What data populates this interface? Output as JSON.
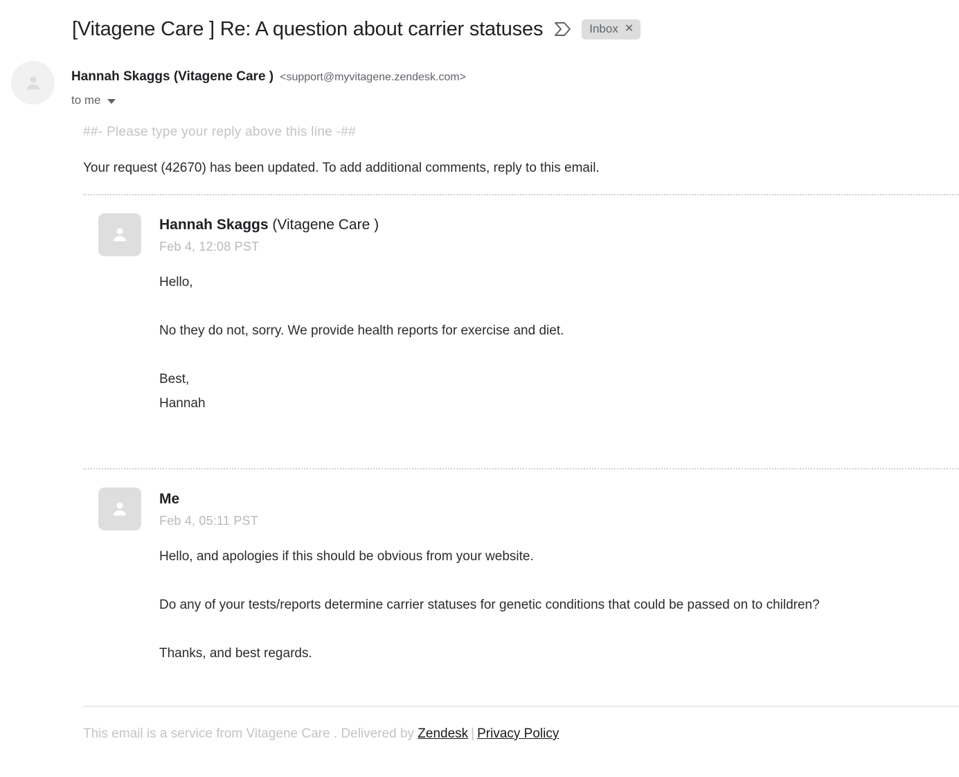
{
  "header": {
    "subject": "[Vitagene Care ] Re: A question about carrier statuses",
    "inbox_arrow_icon": "inbox-arrow-icon",
    "label": "Inbox",
    "label_close": "✕"
  },
  "sender": {
    "avatar_icon": "person-avatar-icon",
    "name": "Hannah Skaggs (Vitagene Care )",
    "email": "<support@myvitagene.zendesk.com>",
    "recipients": "to me",
    "expand_icon": "chevron-down-icon"
  },
  "notice": {
    "reply_above": "##- Please type your reply above this line -##",
    "request_updated": "Your request (42670) has been updated. To add additional comments, reply to this email."
  },
  "comments": [
    {
      "avatar_icon": "person-avatar-icon",
      "author_name": "Hannah Skaggs",
      "author_org": " (Vitagene Care )",
      "date": "Feb 4, 12:08 PST",
      "paragraphs": [
        "Hello,",
        "No they do not, sorry. We provide health reports for exercise and diet.",
        "Best,",
        "Hannah"
      ]
    },
    {
      "avatar_icon": "person-avatar-icon",
      "author_name": "Me",
      "author_org": "",
      "date": "Feb 4, 05:11 PST",
      "paragraphs": [
        "Hello, and apologies if this should be obvious from your website.",
        "Do any of your tests/reports determine carrier statuses for genetic conditions that could be passed on to children?",
        "Thanks, and best regards."
      ]
    }
  ],
  "footer": {
    "service_text": "This email is a service from Vitagene Care . Delivered by ",
    "zendesk_link": "Zendesk",
    "separator": "|",
    "privacy_link": "Privacy Policy"
  },
  "colors": {
    "text_primary": "#2b2b2b",
    "text_muted": "#5f6368",
    "text_faint": "#c4c4c4",
    "chip_bg": "#ddddde",
    "avatar_bg": "#dedede"
  }
}
